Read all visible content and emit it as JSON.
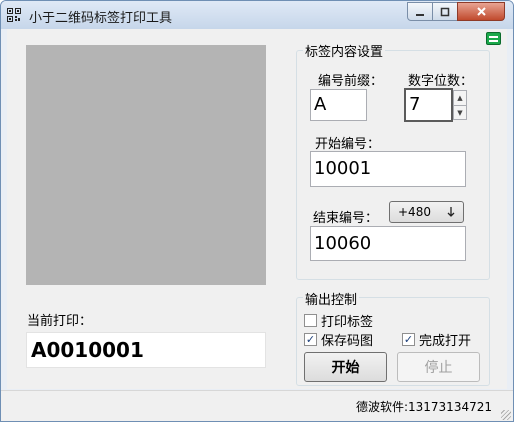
{
  "window": {
    "title": "小于二维码标签打印工具",
    "icons": {
      "app": "qr-code-icon",
      "menu": "menu-icon",
      "minimize": "minimize-icon",
      "maximize": "maximize-icon",
      "close": "close-icon"
    }
  },
  "preview": {
    "current_print_label": "当前打印：",
    "current_print_value": "A0010001"
  },
  "label_settings": {
    "group_title": "标签内容设置",
    "prefix_label": "编号前缀：",
    "prefix_value": "A",
    "digits_label": "数字位数：",
    "digits_value": "7",
    "start_label": "开始编号：",
    "start_value": "10001",
    "end_label": "结束编号：",
    "offset_button": "+480",
    "end_value": "10060"
  },
  "output_control": {
    "group_title": "输出控制",
    "print_labels": {
      "label": "打印标签",
      "checked": false
    },
    "save_code_image": {
      "label": "保存码图",
      "checked": true
    },
    "open_on_finish": {
      "label": "完成打开",
      "checked": true
    },
    "start_button": "开始",
    "stop_button": "停止"
  },
  "status_bar": {
    "text": "德波软件:13173134721"
  }
}
